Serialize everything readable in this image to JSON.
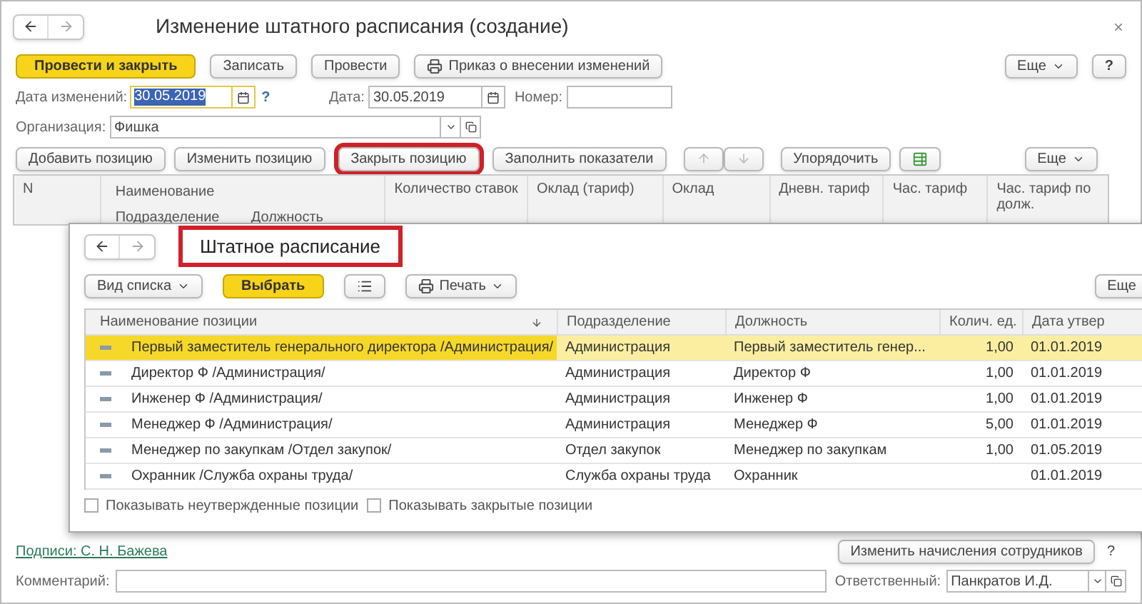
{
  "window": {
    "title": "Изменение штатного расписания (создание)",
    "close": "×"
  },
  "toolbar": {
    "buttons": [
      {
        "label": "Провести и закрыть",
        "kind": "primary"
      },
      {
        "label": "Записать",
        "kind": "plain"
      },
      {
        "label": "Провести",
        "kind": "plain"
      },
      {
        "label": "Приказ о внесении изменений",
        "kind": "print"
      }
    ],
    "more": "Еще",
    "help": "?"
  },
  "change_date": {
    "label": "Дата изменений:",
    "value": "30.05.2019",
    "hint": "?"
  },
  "date": {
    "label": "Дата:",
    "value": "30.05.2019"
  },
  "number": {
    "label": "Номер:"
  },
  "organization": {
    "label": "Организация:",
    "value": "Фишка"
  },
  "positions_toolbar": {
    "buttons": [
      {
        "label": "Добавить позицию",
        "highlighted": false
      },
      {
        "label": "Изменить позицию",
        "highlighted": false
      },
      {
        "label": "Закрыть позицию",
        "highlighted": true
      },
      {
        "label": "Заполнить показатели",
        "highlighted": false
      }
    ],
    "sort": "Упорядочить",
    "more": "Еще"
  },
  "positions_table": {
    "columns": [
      "N",
      "Наименование",
      "Количество ставок",
      "Оклад (тариф)",
      "Оклад",
      "Дневн. тариф",
      "Час. тариф",
      "Час. тариф по долж."
    ],
    "subcolumns": [
      "Подразделение",
      "Должность"
    ]
  },
  "list_window": {
    "title": "Штатное расписание",
    "title_highlighted": true,
    "toolbar": {
      "view": "Вид списка",
      "select": "Выбрать",
      "print": "Печать",
      "more": "Еще"
    },
    "columns": [
      "Наименование позиции",
      "Подразделение",
      "Должность",
      "Колич. ед.",
      "Дата утвер"
    ],
    "rows": [
      {
        "cells": [
          "Первый заместитель генерального директора /Администрация/",
          "Администрация",
          "Первый заместитель генер...",
          "1,00",
          "01.01.2019"
        ],
        "selected": true
      },
      {
        "cells": [
          "Директор Ф /Администрация/",
          "Администрация",
          "Директор Ф",
          "1,00",
          "01.01.2019"
        ],
        "selected": false
      },
      {
        "cells": [
          "Инженер Ф /Администрация/",
          "Администрация",
          "Инженер Ф",
          "1,00",
          "01.01.2019"
        ],
        "selected": false
      },
      {
        "cells": [
          "Менеджер Ф /Администрация/",
          "Администрация",
          "Менеджер Ф",
          "5,00",
          "01.01.2019"
        ],
        "selected": false
      },
      {
        "cells": [
          "Менеджер по закупкам /Отдел закупок/",
          "Отдел закупок",
          "Менеджер по закупкам",
          "1,00",
          "01.05.2019"
        ],
        "selected": false
      },
      {
        "cells": [
          "Охранник /Служба охраны труда/",
          "Служба охраны труда",
          "Охранник",
          "",
          "01.01.2019"
        ],
        "selected": false
      }
    ],
    "checkboxes": [
      {
        "label": "Показывать неутвержденные позиции",
        "checked": false
      },
      {
        "label": "Показывать закрытые позиции",
        "checked": false
      }
    ]
  },
  "footer": {
    "signatures_link": "Подписи: С. Н. Бажева",
    "accruals_button": "Изменить начисления сотрудников",
    "help": "?",
    "comment_label": "Комментарий:",
    "responsible_label": "Ответственный:",
    "responsible_value": "Панкратов И.Д."
  }
}
